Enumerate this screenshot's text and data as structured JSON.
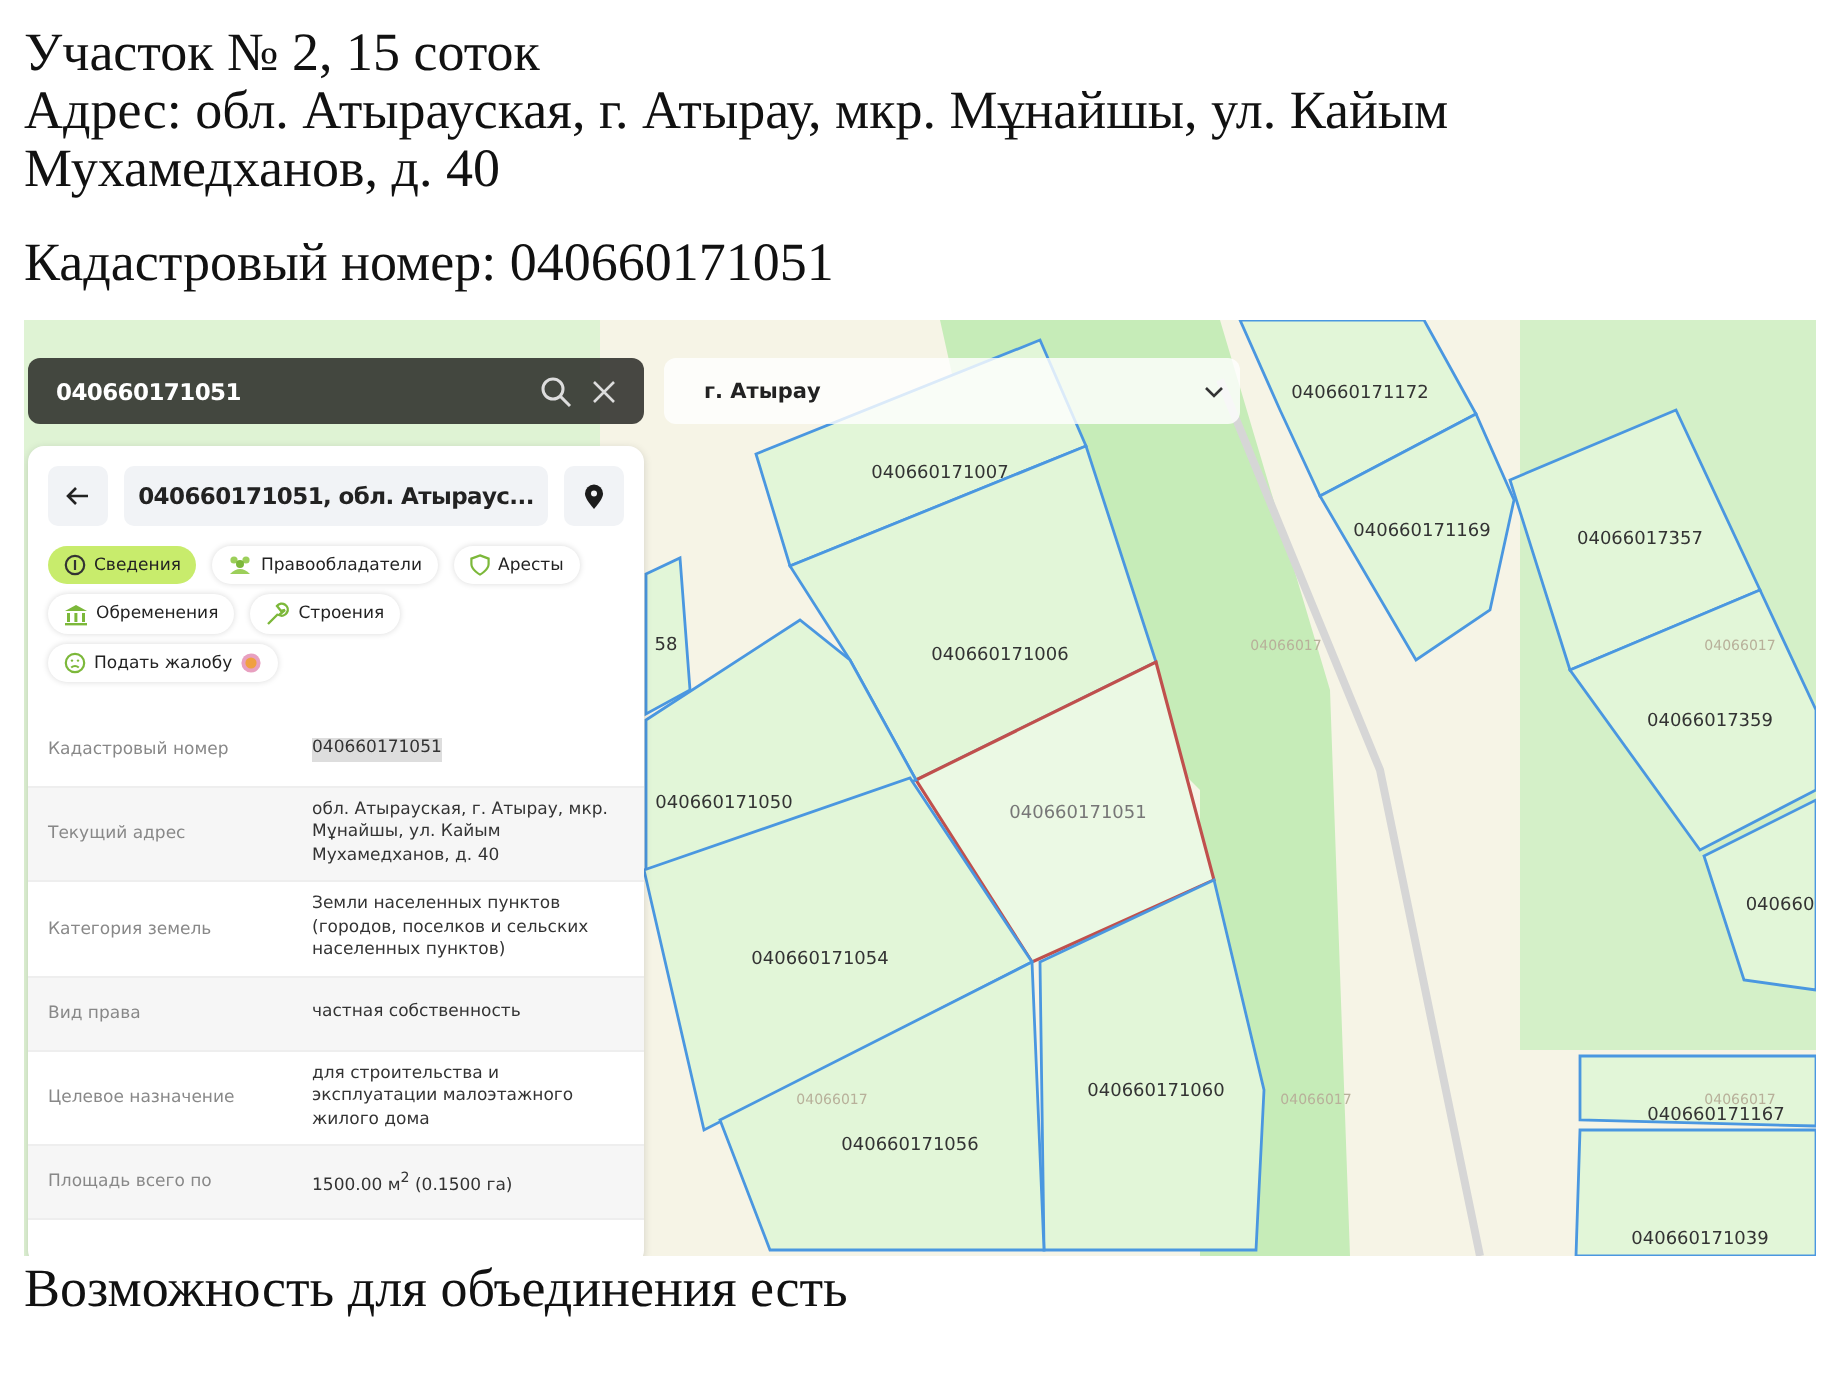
{
  "heading": {
    "title": "Участок № 2, 15 соток",
    "address": "Адрес: обл. Атырауская, г. Атырау, мкр. Мұнайшы, ул. Кайым Мухамедханов, д. 40",
    "cadastral": "Кадастровый номер: 040660171051"
  },
  "map": {
    "search": {
      "value": "040660171051"
    },
    "region": {
      "value": "г. Атырау"
    },
    "parcels": [
      {
        "label": "040660171172",
        "selected": false
      },
      {
        "label": "040660171169",
        "selected": false
      },
      {
        "label": "04066017357",
        "selected": false
      },
      {
        "label": "04066017359",
        "selected": false
      },
      {
        "label": "040660171007",
        "selected": false
      },
      {
        "label": "040660171006",
        "selected": false
      },
      {
        "label": "040660171051",
        "selected": true
      },
      {
        "label": "040660171050",
        "selected": false
      },
      {
        "label": "040660171054",
        "selected": false
      },
      {
        "label": "040660171060",
        "selected": false
      },
      {
        "label": "040660171056",
        "selected": false
      },
      {
        "label": "040660171167",
        "selected": false
      },
      {
        "label": "040660171039",
        "selected": false
      },
      {
        "label": "040660",
        "selected": false
      },
      {
        "label": "58",
        "selected": false
      }
    ],
    "quarter_labels": [
      "04066017",
      "04066017",
      "04066017",
      "04066017",
      "04066017"
    ],
    "card": {
      "title": "040660171051, обл. Атыраус...",
      "tabs": [
        {
          "kind": "info",
          "label": "Сведения",
          "selected": true
        },
        {
          "kind": "owners",
          "label": "Правообладатели",
          "selected": false
        },
        {
          "kind": "arrests",
          "label": "Аресты",
          "selected": false
        },
        {
          "kind": "encumbrances",
          "label": "Обременения",
          "selected": false
        },
        {
          "kind": "buildings",
          "label": "Строения",
          "selected": false
        },
        {
          "kind": "complaint",
          "label": "Подать жалобу",
          "selected": false
        }
      ],
      "rows": [
        {
          "label": "Кадастровый номер",
          "value": "040660171051",
          "highlighted": true
        },
        {
          "label": "Текущий адрес",
          "value": "обл. Атырауская, г. Атырау, мкр. Мұнайшы, ул. Кайым Мухамедханов, д. 40",
          "highlighted": false
        },
        {
          "label": "Категория земель",
          "value": "Земли населенных пунктов (городов, поселков и сельских населенных пунктов)",
          "highlighted": false
        },
        {
          "label": "Вид права",
          "value": "частная собственность",
          "highlighted": false
        },
        {
          "label": "Целевое назначение",
          "value": "для строительства и эксплуатации малоэтажного жилого дома",
          "highlighted": false
        },
        {
          "label": "Площадь всего по",
          "value": "1500.00 м$^{2}$ (0.1500 га)",
          "highlighted": false
        }
      ]
    }
  },
  "footer": "Возможность для объединения есть"
}
